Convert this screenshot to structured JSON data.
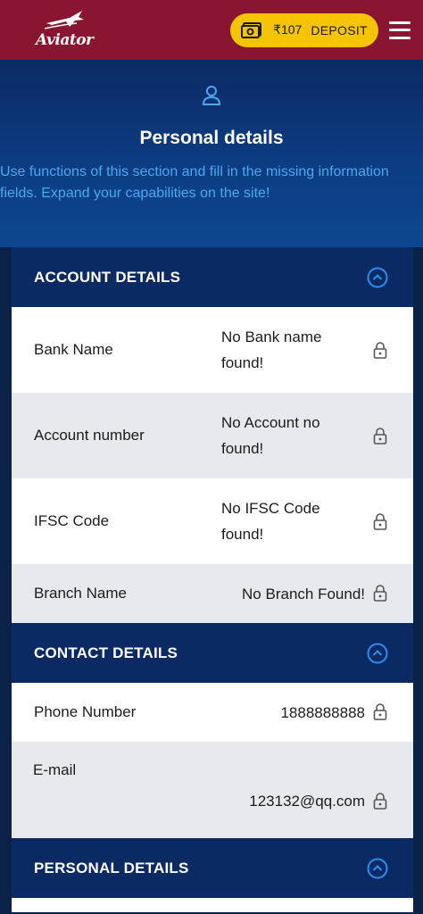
{
  "app": {
    "logo_text": "Aviator"
  },
  "header": {
    "balance": "₹107",
    "deposit_label": "DEPOSIT",
    "icons": [
      "wallet-icon",
      "menu-icon"
    ]
  },
  "hero": {
    "title": "Personal details",
    "description": "Use functions of this section and fill in the missing information fields. Expand your capabilities on the site!",
    "icon": "user-icon"
  },
  "sections": {
    "account": {
      "title": "ACCOUNT DETAILS",
      "rows": [
        {
          "label": "Bank Name",
          "value": "No Bank name found!"
        },
        {
          "label": "Account number",
          "value": "No Account no found!"
        },
        {
          "label": "IFSC Code",
          "value": "No IFSC Code found!"
        },
        {
          "label": "Branch Name",
          "value": "No Branch Found!"
        }
      ]
    },
    "contact": {
      "title": "CONTACT DETAILS",
      "rows": [
        {
          "label": "Phone Number",
          "value": "1888888888"
        },
        {
          "label": "E-mail",
          "value": "123132@qq.com"
        }
      ]
    },
    "personal": {
      "title": "PERSONAL DETAILS"
    }
  },
  "colors": {
    "topbar": "#8a1530",
    "deposit": "#f5c400",
    "section_header": "#0b2a63",
    "accent_link": "#4aa8ee",
    "chevron": "#2a8ff0"
  }
}
